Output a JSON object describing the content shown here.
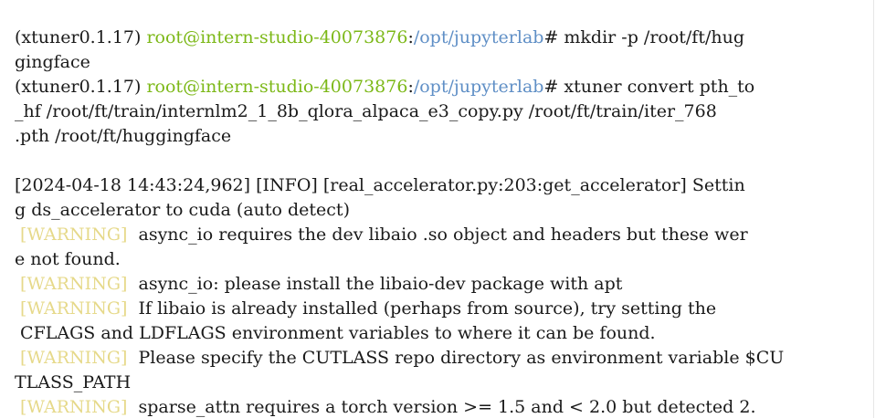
{
  "terminal": {
    "prompt": {
      "env": "(xtuner0.1.17)",
      "user_host": "root@intern-studio-40073876",
      "colon": ":",
      "path": "/opt/jupyterlab",
      "hash": "#"
    },
    "cmd1_line1": " mkdir -p /root/ft/hug",
    "cmd1_line2": "gingface",
    "cmd2_line1": " xtuner convert pth_to",
    "cmd2_line2": "_hf /root/ft/train/internlm2_1_8b_qlora_alpaca_e3_copy.py /root/ft/train/iter_768",
    "cmd2_line3": ".pth /root/ft/huggingface",
    "info_line1": "[2024-04-18 14:43:24,962] [INFO] [real_accelerator.py:203:get_accelerator] Settin",
    "info_line2": "g ds_accelerator to cuda (auto detect)",
    "warning_tag": " [WARNING] ",
    "warn1_line1": " async_io requires the dev libaio .so object and headers but these wer",
    "warn1_line2": "e not found.",
    "warn2_line1": " async_io: please install the libaio-dev package with apt",
    "warn3_line1": " If libaio is already installed (perhaps from source), try setting the",
    "warn3_line2": " CFLAGS and LDFLAGS environment variables to where it can be found.",
    "warn4_line1": " Please specify the CUTLASS repo directory as environment variable $CU",
    "warn4_line2": "TLASS_PATH",
    "warn5_line1": " sparse_attn requires a torch version >= 1.5 and < 2.0 but detected 2."
  }
}
